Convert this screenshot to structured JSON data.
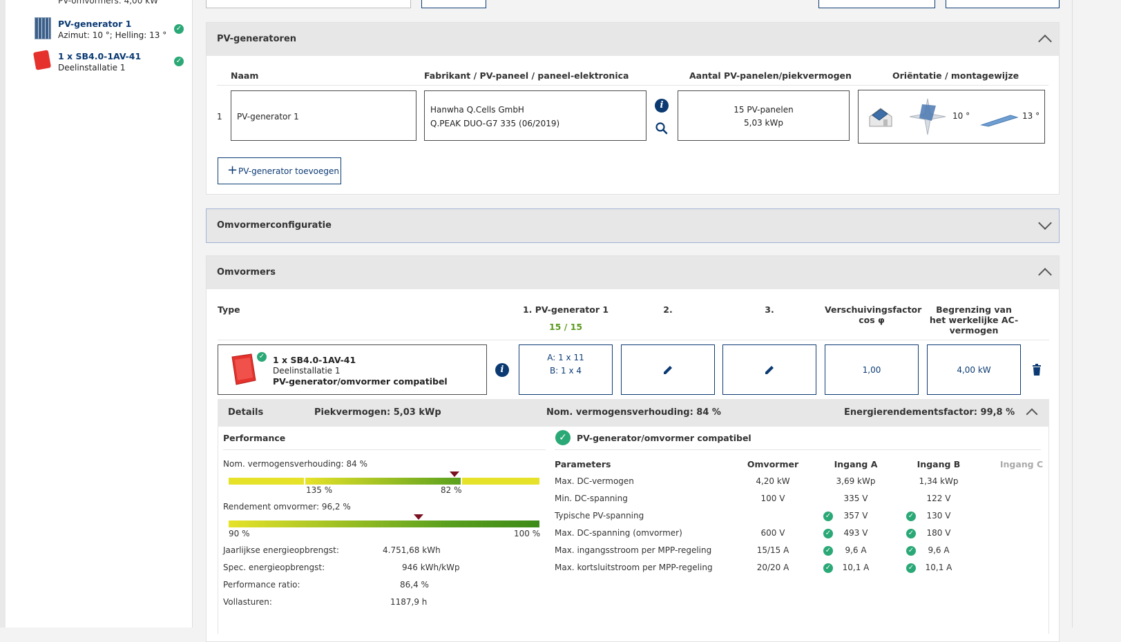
{
  "sidebar": {
    "top_cut_text": "PV-omvormers: 4,00 kW",
    "items": [
      {
        "title": "PV-generator 1",
        "subtitle": "Azimut: 10 °; Helling: 13 °"
      },
      {
        "title": "1 x SB4.0-1AV-41",
        "subtitle": "Deelinstallatie 1"
      }
    ]
  },
  "pv_section": {
    "title": "PV-generatoren",
    "columns": [
      "Naam",
      "Fabrikant / PV-paneel / paneel-elektronica",
      "Aantal PV-panelen/piekvermogen",
      "Oriëntatie / montagewijze"
    ],
    "row": {
      "index": "1",
      "name": "PV-generator 1",
      "manufacturer": "Hanwha Q.Cells GmbH",
      "panel": "Q.PEAK DUO-G7 335 (06/2019)",
      "count": "15 PV-panelen",
      "peak": "5,03 kWp",
      "azimuth": "10 °",
      "tilt": "13 °"
    },
    "add_button": "PV-generator toevoegen"
  },
  "inverter_config": {
    "title": "Omvormerconfiguratie"
  },
  "inverters": {
    "title": "Omvormers",
    "col_type": "Type",
    "col_gen1": "1. PV-generator 1",
    "col_gen1_count": "15 / 15",
    "col_2": "2.",
    "col_3": "3.",
    "col_cosphi": "Verschuivingsfactor cos φ",
    "col_limit": "Begrenzing van het werkelijke AC-vermogen",
    "row": {
      "name": "1 x SB4.0-1AV-41",
      "sub": "Deelinstallatie 1",
      "compat": "PV-generator/omvormer compatibel",
      "input_a": "A: 1 x 11",
      "input_b": "B: 1 x 4",
      "cosphi": "1,00",
      "limit": "4,00 kW"
    }
  },
  "details": {
    "label": "Details",
    "peak": "Piekvermogen: 5,03 kWp",
    "ratio": "Nom. vermogensverhouding: 84 %",
    "energy_factor": "Energierendementsfactor: 99,8 %",
    "performance_title": "Performance",
    "nom_ratio_label": "Nom. vermogensverhouding: 84 %",
    "nom_ratio_value": 84,
    "scale1_left": "135 %",
    "scale1_right": "82 %",
    "efficiency_label": "Rendement omvormer: 96,2 %",
    "efficiency_value": 96.2,
    "scale2_left": "90 %",
    "scale2_right": "100 %",
    "stats": [
      {
        "label": "Jaarlijkse energieopbrengst:",
        "value": "4.751,68 kWh"
      },
      {
        "label": "Spec. energieopbrengst:",
        "value": "946 kWh/kWp"
      },
      {
        "label": "Performance ratio:",
        "value": "86,4 %"
      },
      {
        "label": "Vollasturen:",
        "value": "1187,9 h"
      }
    ],
    "compat_title": "PV-generator/omvormer compatibel",
    "param_headers": [
      "Parameters",
      "Omvormer",
      "Ingang A",
      "Ingang B",
      "Ingang C"
    ],
    "params": [
      {
        "name": "Max. DC-vermogen",
        "inv": "4,20 kW",
        "a": "3,69 kWp",
        "b": "1,34 kWp",
        "check": false
      },
      {
        "name": "Min. DC-spanning",
        "inv": "100 V",
        "a": "335 V",
        "b": "122 V",
        "check": false
      },
      {
        "name": "Typische PV-spanning",
        "inv": "",
        "a": "357 V",
        "b": "130 V",
        "check": true
      },
      {
        "name": "Max. DC-spanning (omvormer)",
        "inv": "600 V",
        "a": "493 V",
        "b": "180 V",
        "check": true
      },
      {
        "name": "Max. ingangsstroom per MPP-regeling",
        "inv": "15/15 A",
        "a": "9,6 A",
        "b": "9,6 A",
        "check": true
      },
      {
        "name": "Max. kortsluitstroom per MPP-regeling",
        "inv": "20/20 A",
        "a": "10,1 A",
        "b": "10,1 A",
        "check": true
      }
    ]
  }
}
